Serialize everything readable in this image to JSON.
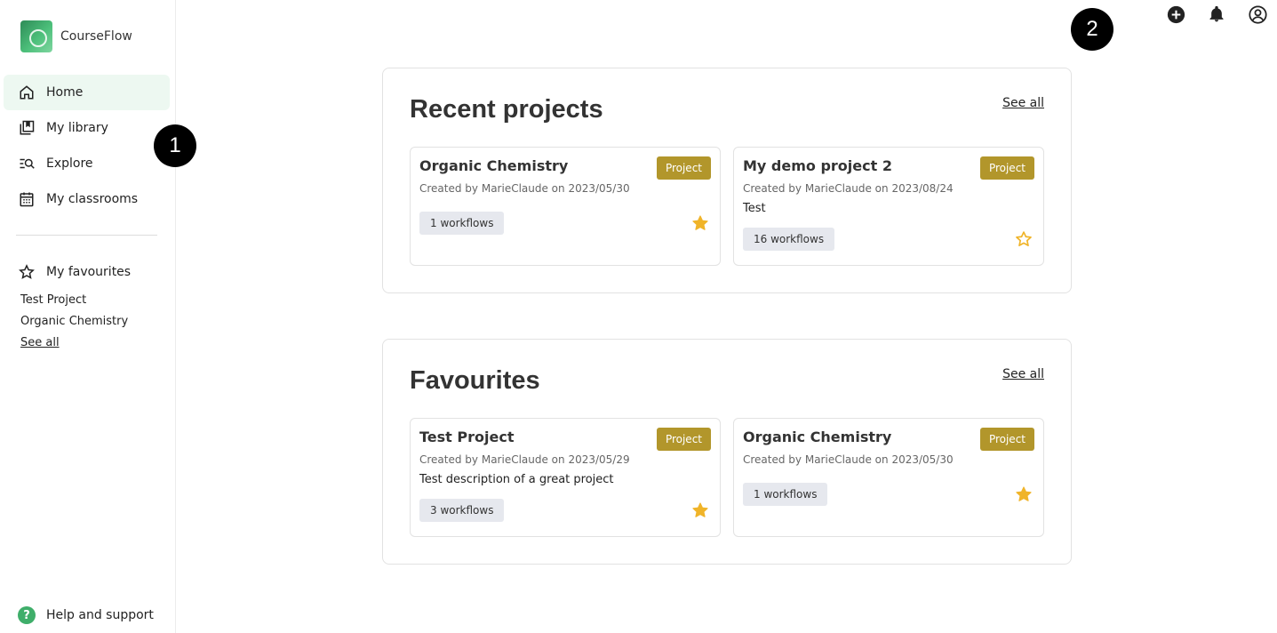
{
  "app": {
    "name": "CourseFlow"
  },
  "colors": {
    "accent": "#3fae6a",
    "badge": "#b2962b",
    "star": "#f0b429"
  },
  "sidebar": {
    "items": [
      {
        "label": "Home",
        "icon": "home-icon",
        "active": true
      },
      {
        "label": "My library",
        "icon": "library-icon"
      },
      {
        "label": "Explore",
        "icon": "explore-icon"
      },
      {
        "label": "My classrooms",
        "icon": "calendar-icon"
      }
    ],
    "favourites": {
      "title": "My favourites",
      "items": [
        "Test Project",
        "Organic Chemistry"
      ],
      "see_all": "See all"
    },
    "help": "Help and support"
  },
  "markers": [
    "1",
    "2"
  ],
  "topbar": {
    "icons": [
      "add-icon",
      "bell-icon",
      "account-icon"
    ]
  },
  "recent": {
    "title": "Recent projects",
    "see_all": "See all",
    "cards": [
      {
        "title": "Organic Chemistry",
        "badge": "Project",
        "meta": "Created by MarieClaude on 2023/05/30",
        "description": "",
        "chip": "1 workflows",
        "favourite": true
      },
      {
        "title": "My demo project 2",
        "badge": "Project",
        "meta": "Created by MarieClaude on 2023/08/24",
        "description": "Test",
        "chip": "16 workflows",
        "favourite": false
      }
    ]
  },
  "favourites": {
    "title": "Favourites",
    "see_all": "See all",
    "cards": [
      {
        "title": "Test Project",
        "badge": "Project",
        "meta": "Created by MarieClaude on 2023/05/29",
        "description": "Test description of a great project",
        "chip": "3 workflows",
        "favourite": true
      },
      {
        "title": "Organic Chemistry",
        "badge": "Project",
        "meta": "Created by MarieClaude on 2023/05/30",
        "description": "",
        "chip": "1 workflows",
        "favourite": true
      }
    ]
  }
}
